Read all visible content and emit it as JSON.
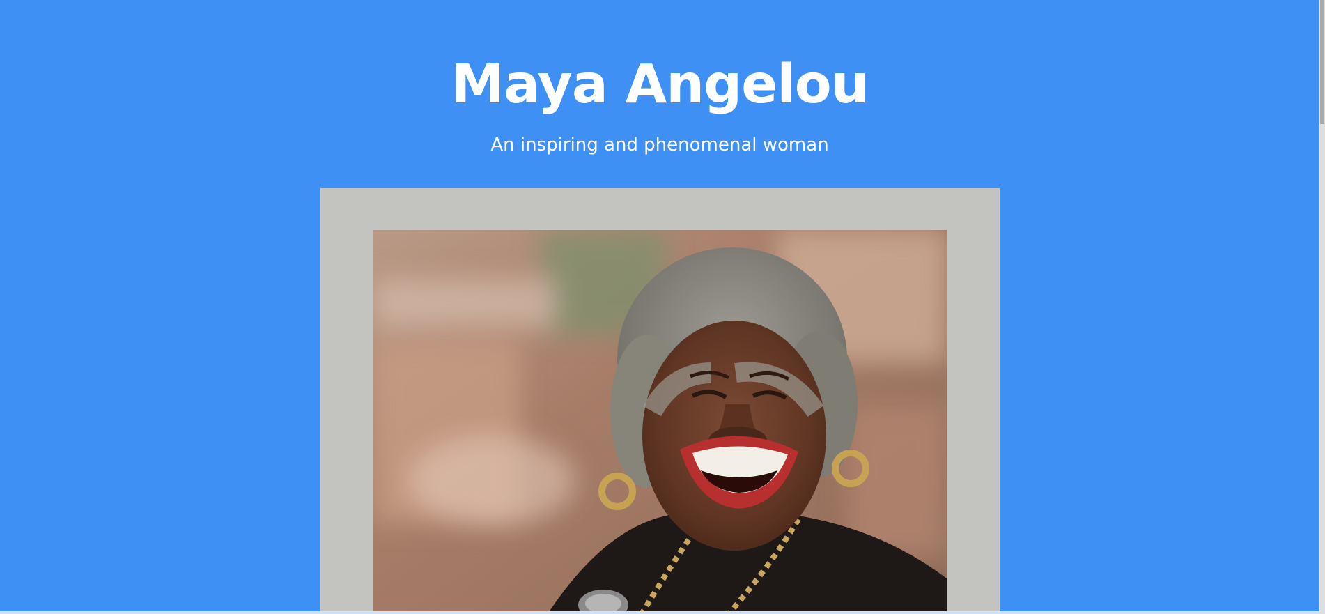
{
  "hero": {
    "title": "Maya Angelou",
    "subtitle": "An inspiring and phenomenal woman"
  },
  "image": {
    "alt": "Maya Angelou laughing"
  },
  "colors": {
    "background": "#3f90f4",
    "frame": "#c3c3bf",
    "text": "#ffffff"
  }
}
